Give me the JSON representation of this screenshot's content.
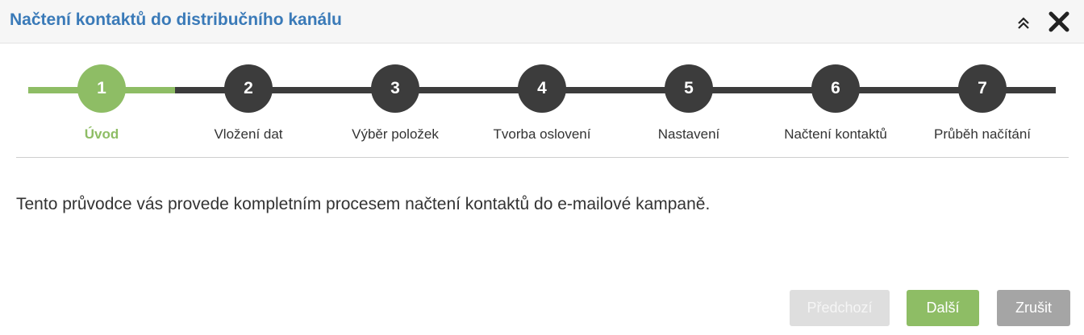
{
  "dialog": {
    "title": "Načtení kontaktů do distribučního kanálu",
    "collapse_icon": "double-chevron-up-icon",
    "close_icon": "close-x-icon"
  },
  "wizard": {
    "current_step": 1,
    "completed_color": "#8ebd65",
    "pending_color": "#3c3c3c",
    "steps": [
      {
        "number": "1",
        "label": "Úvod"
      },
      {
        "number": "2",
        "label": "Vložení dat"
      },
      {
        "number": "3",
        "label": "Výběr položek"
      },
      {
        "number": "4",
        "label": "Tvorba oslovení"
      },
      {
        "number": "5",
        "label": "Nastavení"
      },
      {
        "number": "6",
        "label": "Načtení kontaktů"
      },
      {
        "number": "7",
        "label": "Průběh načítání"
      }
    ]
  },
  "content": {
    "intro_text": "Tento průvodce vás provede kompletním procesem načtení kontaktů do e-mailové kampaně."
  },
  "footer": {
    "prev_label": "Předchozí",
    "next_label": "Další",
    "cancel_label": "Zrušit",
    "prev_disabled": true
  },
  "colors": {
    "title": "#3a7ab8",
    "primary_button": "#8ebd65",
    "cancel_button": "#a5a5a5",
    "disabled_button": "#dedede"
  }
}
